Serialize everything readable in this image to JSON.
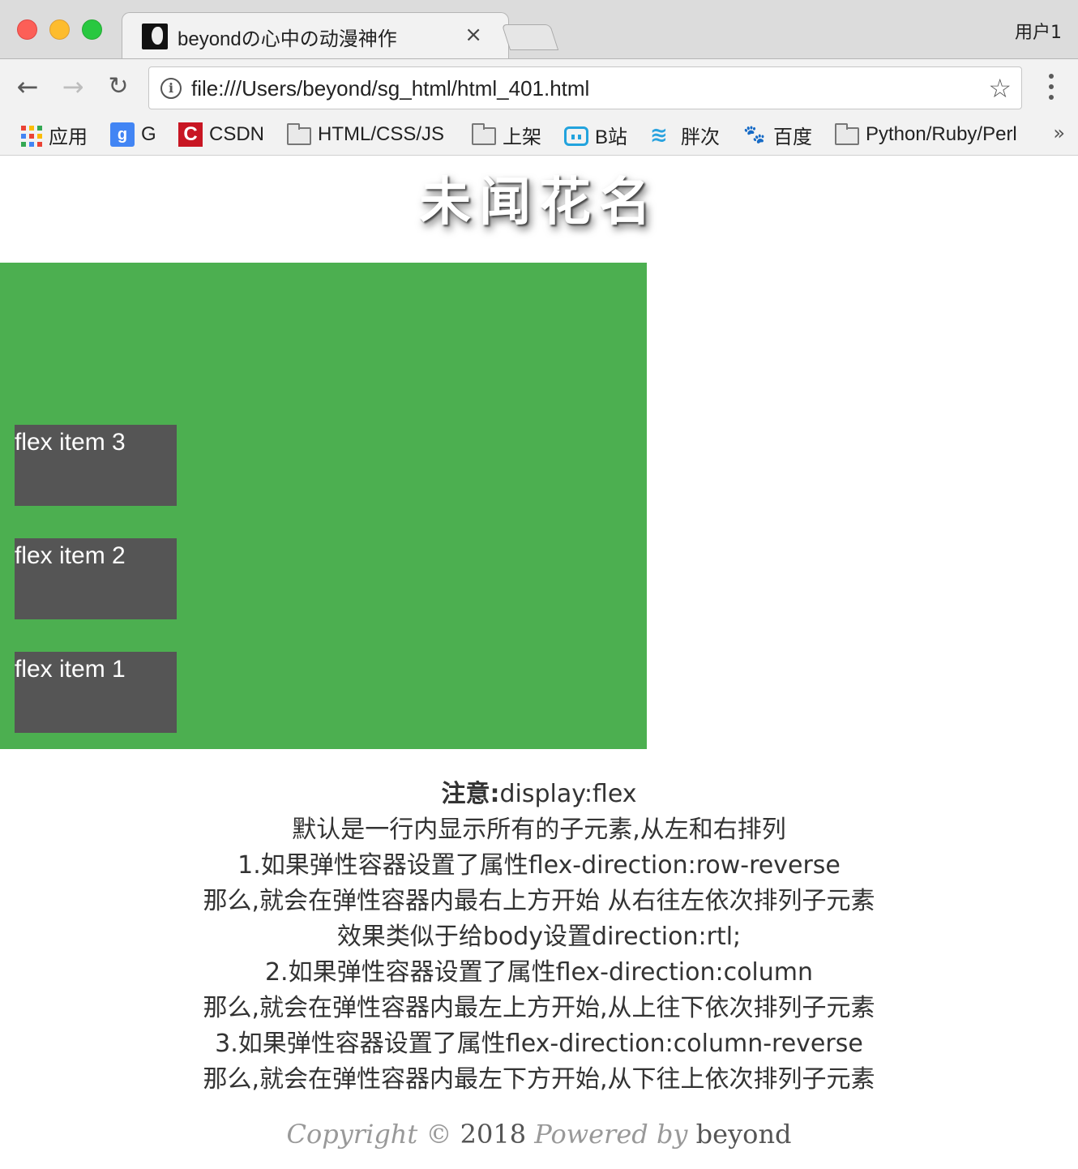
{
  "browser": {
    "tab_title": "beyondの心中の动漫神作",
    "tab_close": "×",
    "profile": "用户1",
    "url": "file:///Users/beyond/sg_html/html_401.html",
    "nav": {
      "back": "←",
      "forward": "→",
      "reload": "↻"
    },
    "star": "☆",
    "bookmarks": [
      {
        "label": "应用",
        "icon": "apps-grid-icon"
      },
      {
        "label": "G",
        "icon": "google-icon"
      },
      {
        "label": "CSDN",
        "icon": "csdn-icon"
      },
      {
        "label": "HTML/CSS/JS",
        "icon": "folder-icon"
      },
      {
        "label": "上架",
        "icon": "folder-icon"
      },
      {
        "label": "B站",
        "icon": "bilibili-icon"
      },
      {
        "label": "胖次",
        "icon": "pangci-icon"
      },
      {
        "label": "百度",
        "icon": "baidu-icon"
      },
      {
        "label": "Python/Ruby/Perl",
        "icon": "folder-icon"
      }
    ],
    "bookmarks_more": "»"
  },
  "page": {
    "title": "未闻花名",
    "flex_items": [
      "flex item 1",
      "flex item 2",
      "flex item 3"
    ],
    "notes": {
      "label": "注意:",
      "line0_rest": "display:flex",
      "lines": [
        "默认是一行内显示所有的子元素,从左和右排列",
        "1.如果弹性容器设置了属性flex-direction:row-reverse",
        "那么,就会在弹性容器内最右上方开始 从右往左依次排列子元素",
        "效果类似于给body设置direction:rtl;",
        "2.如果弹性容器设置了属性flex-direction:column",
        "那么,就会在弹性容器内最左上方开始,从上往下依次排列子元素",
        "3.如果弹性容器设置了属性flex-direction:column-reverse",
        "那么,就会在弹性容器内最左下方开始,从下往上依次排列子元素"
      ]
    },
    "footer": {
      "copyright": "Copyright",
      "symbol": "©",
      "year": "2018",
      "powered_by": "Powered by",
      "author": "beyond"
    }
  },
  "colors": {
    "container": "#4caf50",
    "item": "#555555"
  }
}
